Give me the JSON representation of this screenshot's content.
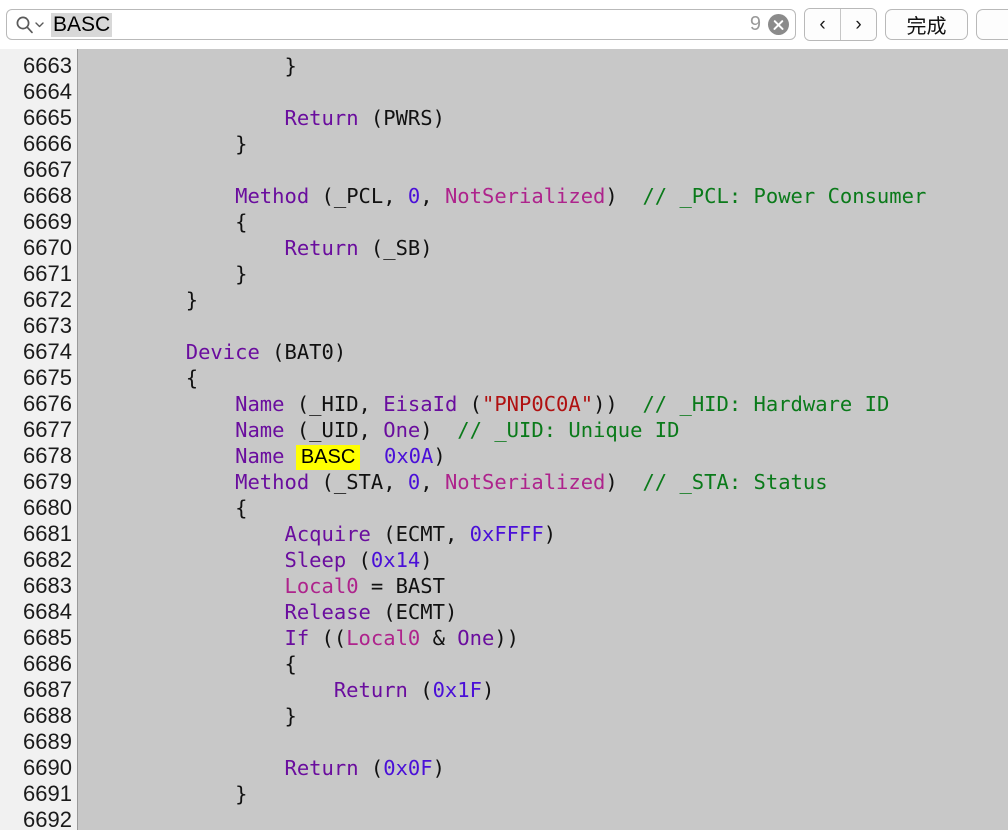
{
  "findbar": {
    "search_icon": "search-magnifier-icon",
    "dropdown_icon": "chevron-down-icon",
    "query_value": "BASC",
    "placeholder": "",
    "match_count": "9",
    "clear_icon": "clear-circle-x-icon",
    "prev_label": "‹",
    "next_label": "›",
    "done_label": "完成"
  },
  "editor": {
    "highlight_term": "BASC",
    "highlight_color": "#ffff00",
    "gutter_bg": "#f1f1f1",
    "code_bg": "#c8c8c8",
    "colors": {
      "keyword": "#6a0d9e",
      "keyword_alt": "#ae238c",
      "number": "#4a0fd8",
      "string": "#b01010",
      "comment": "#0a7a1a",
      "plain": "#111111"
    },
    "line_numbers": [
      "6663",
      "6664",
      "6665",
      "6666",
      "6667",
      "6668",
      "6669",
      "6670",
      "6671",
      "6672",
      "6673",
      "6674",
      "6675",
      "6676",
      "6677",
      "6678",
      "6679",
      "6680",
      "6681",
      "6682",
      "6683",
      "6684",
      "6685",
      "6686",
      "6687",
      "6688",
      "6689",
      "6690",
      "6691",
      "6692"
    ],
    "lines": [
      {
        "n": "6663",
        "tokens": [
          {
            "t": "                ",
            "c": "pl"
          },
          {
            "t": "}",
            "c": "pl"
          }
        ]
      },
      {
        "n": "6664",
        "tokens": []
      },
      {
        "n": "6665",
        "tokens": [
          {
            "t": "                ",
            "c": "pl"
          },
          {
            "t": "Return",
            "c": "kw"
          },
          {
            "t": " (PWRS)",
            "c": "pl"
          }
        ]
      },
      {
        "n": "6666",
        "tokens": [
          {
            "t": "            ",
            "c": "pl"
          },
          {
            "t": "}",
            "c": "pl"
          }
        ]
      },
      {
        "n": "6667",
        "tokens": []
      },
      {
        "n": "6668",
        "tokens": [
          {
            "t": "            ",
            "c": "pl"
          },
          {
            "t": "Method",
            "c": "kw"
          },
          {
            "t": " (_PCL, ",
            "c": "pl"
          },
          {
            "t": "0",
            "c": "num"
          },
          {
            "t": ", ",
            "c": "pl"
          },
          {
            "t": "NotSerialized",
            "c": "kw2"
          },
          {
            "t": ")  ",
            "c": "pl"
          },
          {
            "t": "// _PCL: Power Consumer",
            "c": "cmt"
          }
        ]
      },
      {
        "n": "6669",
        "tokens": [
          {
            "t": "            ",
            "c": "pl"
          },
          {
            "t": "{",
            "c": "pl"
          }
        ]
      },
      {
        "n": "6670",
        "tokens": [
          {
            "t": "                ",
            "c": "pl"
          },
          {
            "t": "Return",
            "c": "kw"
          },
          {
            "t": " (_SB)",
            "c": "pl"
          }
        ]
      },
      {
        "n": "6671",
        "tokens": [
          {
            "t": "            ",
            "c": "pl"
          },
          {
            "t": "}",
            "c": "pl"
          }
        ]
      },
      {
        "n": "6672",
        "tokens": [
          {
            "t": "        ",
            "c": "pl"
          },
          {
            "t": "}",
            "c": "pl"
          }
        ]
      },
      {
        "n": "6673",
        "tokens": []
      },
      {
        "n": "6674",
        "tokens": [
          {
            "t": "        ",
            "c": "pl"
          },
          {
            "t": "Device",
            "c": "kw"
          },
          {
            "t": " (BAT0)",
            "c": "pl"
          }
        ]
      },
      {
        "n": "6675",
        "tokens": [
          {
            "t": "        ",
            "c": "pl"
          },
          {
            "t": "{",
            "c": "pl"
          }
        ]
      },
      {
        "n": "6676",
        "tokens": [
          {
            "t": "            ",
            "c": "pl"
          },
          {
            "t": "Name",
            "c": "kw"
          },
          {
            "t": " (_HID, ",
            "c": "pl"
          },
          {
            "t": "EisaId",
            "c": "kw"
          },
          {
            "t": " (",
            "c": "pl"
          },
          {
            "t": "\"PNP0C0A\"",
            "c": "str"
          },
          {
            "t": "))  ",
            "c": "pl"
          },
          {
            "t": "// _HID: Hardware ID",
            "c": "cmt"
          }
        ]
      },
      {
        "n": "6677",
        "tokens": [
          {
            "t": "            ",
            "c": "pl"
          },
          {
            "t": "Name",
            "c": "kw"
          },
          {
            "t": " (_UID, ",
            "c": "pl"
          },
          {
            "t": "One",
            "c": "kw"
          },
          {
            "t": ")  ",
            "c": "pl"
          },
          {
            "t": "// _UID: Unique ID",
            "c": "cmt"
          }
        ]
      },
      {
        "n": "6678",
        "tokens": [
          {
            "t": "            ",
            "c": "pl"
          },
          {
            "t": "Name",
            "c": "kw"
          },
          {
            "t": " ",
            "c": "pl"
          },
          {
            "t": "BASC",
            "c": "hl"
          },
          {
            "t": "  ",
            "c": "pl"
          },
          {
            "t": "0x0A",
            "c": "num"
          },
          {
            "t": ")",
            "c": "pl"
          }
        ]
      },
      {
        "n": "6679",
        "tokens": [
          {
            "t": "            ",
            "c": "pl"
          },
          {
            "t": "Method",
            "c": "kw"
          },
          {
            "t": " (_STA, ",
            "c": "pl"
          },
          {
            "t": "0",
            "c": "num"
          },
          {
            "t": ", ",
            "c": "pl"
          },
          {
            "t": "NotSerialized",
            "c": "kw2"
          },
          {
            "t": ")  ",
            "c": "pl"
          },
          {
            "t": "// _STA: Status",
            "c": "cmt"
          }
        ]
      },
      {
        "n": "6680",
        "tokens": [
          {
            "t": "            ",
            "c": "pl"
          },
          {
            "t": "{",
            "c": "pl"
          }
        ]
      },
      {
        "n": "6681",
        "tokens": [
          {
            "t": "                ",
            "c": "pl"
          },
          {
            "t": "Acquire",
            "c": "kw"
          },
          {
            "t": " (ECMT, ",
            "c": "pl"
          },
          {
            "t": "0xFFFF",
            "c": "num"
          },
          {
            "t": ")",
            "c": "pl"
          }
        ]
      },
      {
        "n": "6682",
        "tokens": [
          {
            "t": "                ",
            "c": "pl"
          },
          {
            "t": "Sleep",
            "c": "kw"
          },
          {
            "t": " (",
            "c": "pl"
          },
          {
            "t": "0x14",
            "c": "num"
          },
          {
            "t": ")",
            "c": "pl"
          }
        ]
      },
      {
        "n": "6683",
        "tokens": [
          {
            "t": "                ",
            "c": "pl"
          },
          {
            "t": "Local0",
            "c": "kw2"
          },
          {
            "t": " = BAST",
            "c": "pl"
          }
        ]
      },
      {
        "n": "6684",
        "tokens": [
          {
            "t": "                ",
            "c": "pl"
          },
          {
            "t": "Release",
            "c": "kw"
          },
          {
            "t": " (ECMT)",
            "c": "pl"
          }
        ]
      },
      {
        "n": "6685",
        "tokens": [
          {
            "t": "                ",
            "c": "pl"
          },
          {
            "t": "If",
            "c": "kw"
          },
          {
            "t": " ((",
            "c": "pl"
          },
          {
            "t": "Local0",
            "c": "kw2"
          },
          {
            "t": " & ",
            "c": "pl"
          },
          {
            "t": "One",
            "c": "kw"
          },
          {
            "t": "))",
            "c": "pl"
          }
        ]
      },
      {
        "n": "6686",
        "tokens": [
          {
            "t": "                ",
            "c": "pl"
          },
          {
            "t": "{",
            "c": "pl"
          }
        ]
      },
      {
        "n": "6687",
        "tokens": [
          {
            "t": "                    ",
            "c": "pl"
          },
          {
            "t": "Return",
            "c": "kw"
          },
          {
            "t": " (",
            "c": "pl"
          },
          {
            "t": "0x1F",
            "c": "num"
          },
          {
            "t": ")",
            "c": "pl"
          }
        ]
      },
      {
        "n": "6688",
        "tokens": [
          {
            "t": "                ",
            "c": "pl"
          },
          {
            "t": "}",
            "c": "pl"
          }
        ]
      },
      {
        "n": "6689",
        "tokens": []
      },
      {
        "n": "6690",
        "tokens": [
          {
            "t": "                ",
            "c": "pl"
          },
          {
            "t": "Return",
            "c": "kw"
          },
          {
            "t": " (",
            "c": "pl"
          },
          {
            "t": "0x0F",
            "c": "num"
          },
          {
            "t": ")",
            "c": "pl"
          }
        ]
      },
      {
        "n": "6691",
        "tokens": [
          {
            "t": "            ",
            "c": "pl"
          },
          {
            "t": "}",
            "c": "pl"
          }
        ]
      },
      {
        "n": "6692",
        "tokens": []
      }
    ]
  }
}
